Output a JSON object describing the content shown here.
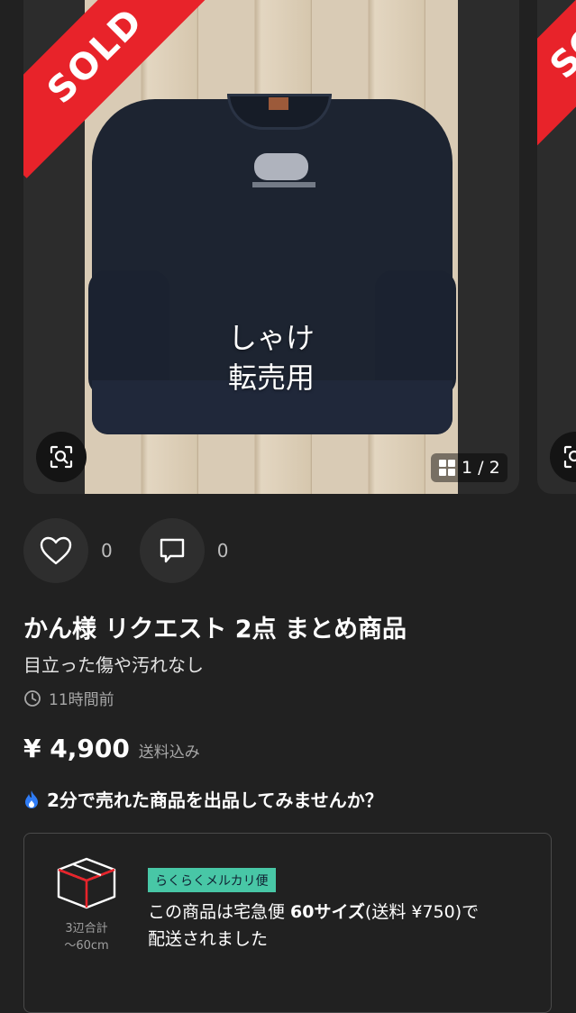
{
  "carousel": {
    "sold_label": "SOLD",
    "overlay_line1": "しゃけ",
    "overlay_line2": "転売用",
    "counter": "1 / 2",
    "next_sold_label": "SOLD"
  },
  "actions": {
    "like_count": "0",
    "comment_count": "0"
  },
  "item": {
    "title": "かん様 リクエスト 2点 まとめ商品",
    "condition": "目立った傷や汚れなし",
    "posted": "11時間前",
    "price": "¥ 4,900",
    "shipping_fee_note": "送料込み"
  },
  "promo": {
    "text": "2分で売れた商品を出品してみませんか？"
  },
  "shipping": {
    "size_label1": "3辺合計",
    "size_label2": "〜60cm",
    "badge": "らくらくメルカリ便",
    "text_prefix": "この商品は宅急便 ",
    "text_size": "60サイズ",
    "text_fee": "(送料 ¥750)で",
    "text_line2": "配送されました"
  },
  "colors": {
    "background": "#212121",
    "sold_red": "#e8232a",
    "badge_green": "#48c7a6",
    "promo_flame": "#2f7cf6"
  }
}
